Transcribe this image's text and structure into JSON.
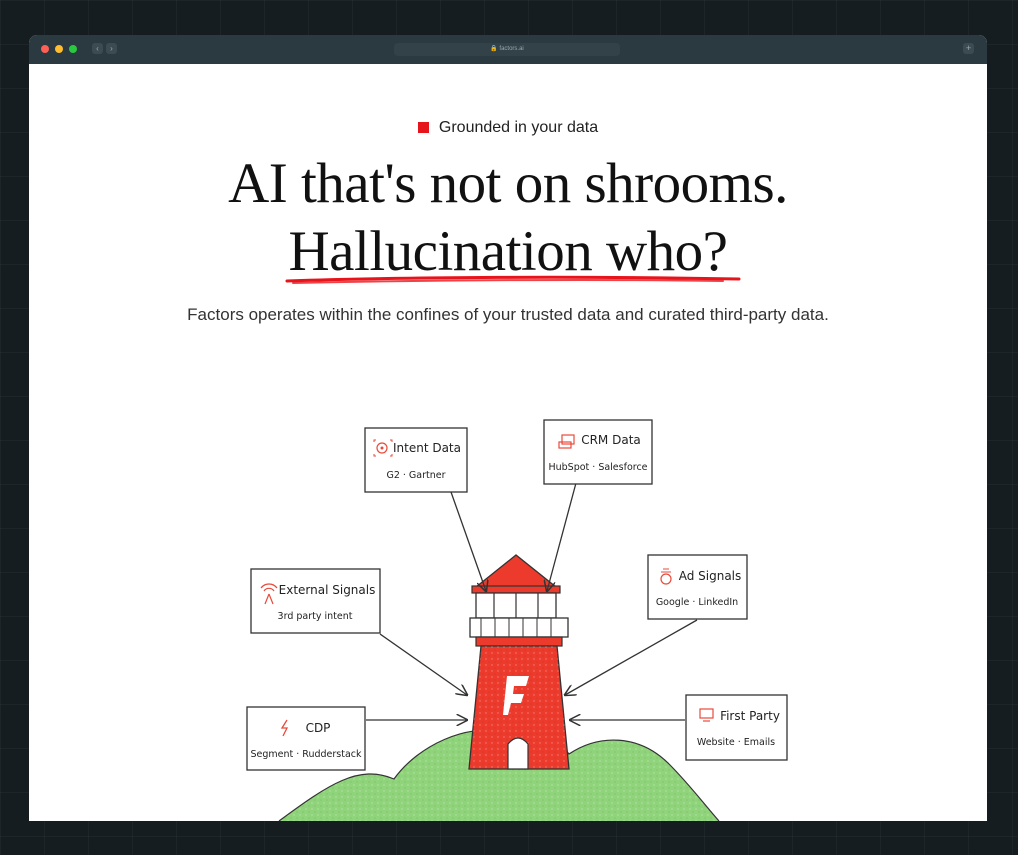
{
  "browser": {
    "url": "factors.ai",
    "back_symbol": "‹",
    "forward_symbol": "›",
    "new_tab_symbol": "+"
  },
  "hero": {
    "eyebrow": "Grounded in your data",
    "headline_line1": "AI that's not on shrooms.",
    "headline_line2": "Hallucination who?",
    "subtitle": "Factors operates within the confines of your trusted data and curated third-party data."
  },
  "sources": [
    {
      "title": "Intent Data",
      "subtitle": "G2 · Gartner",
      "icon": "target-icon"
    },
    {
      "title": "CRM Data",
      "subtitle": "HubSpot · Salesforce",
      "icon": "database-icon"
    },
    {
      "title": "External Signals",
      "subtitle": "3rd party intent",
      "icon": "broadcast-icon"
    },
    {
      "title": "Ad Signals",
      "subtitle": "Google · LinkedIn",
      "icon": "megaphone-icon"
    },
    {
      "title": "CDP",
      "subtitle": "Segment · Rudderstack",
      "icon": "lightning-icon"
    },
    {
      "title": "First Party",
      "subtitle": "Website · Emails",
      "icon": "monitor-icon"
    }
  ],
  "colors": {
    "accent_red": "#e8141b",
    "lighthouse_red": "#ec3b2c",
    "hill_green": "#8fd47a"
  }
}
